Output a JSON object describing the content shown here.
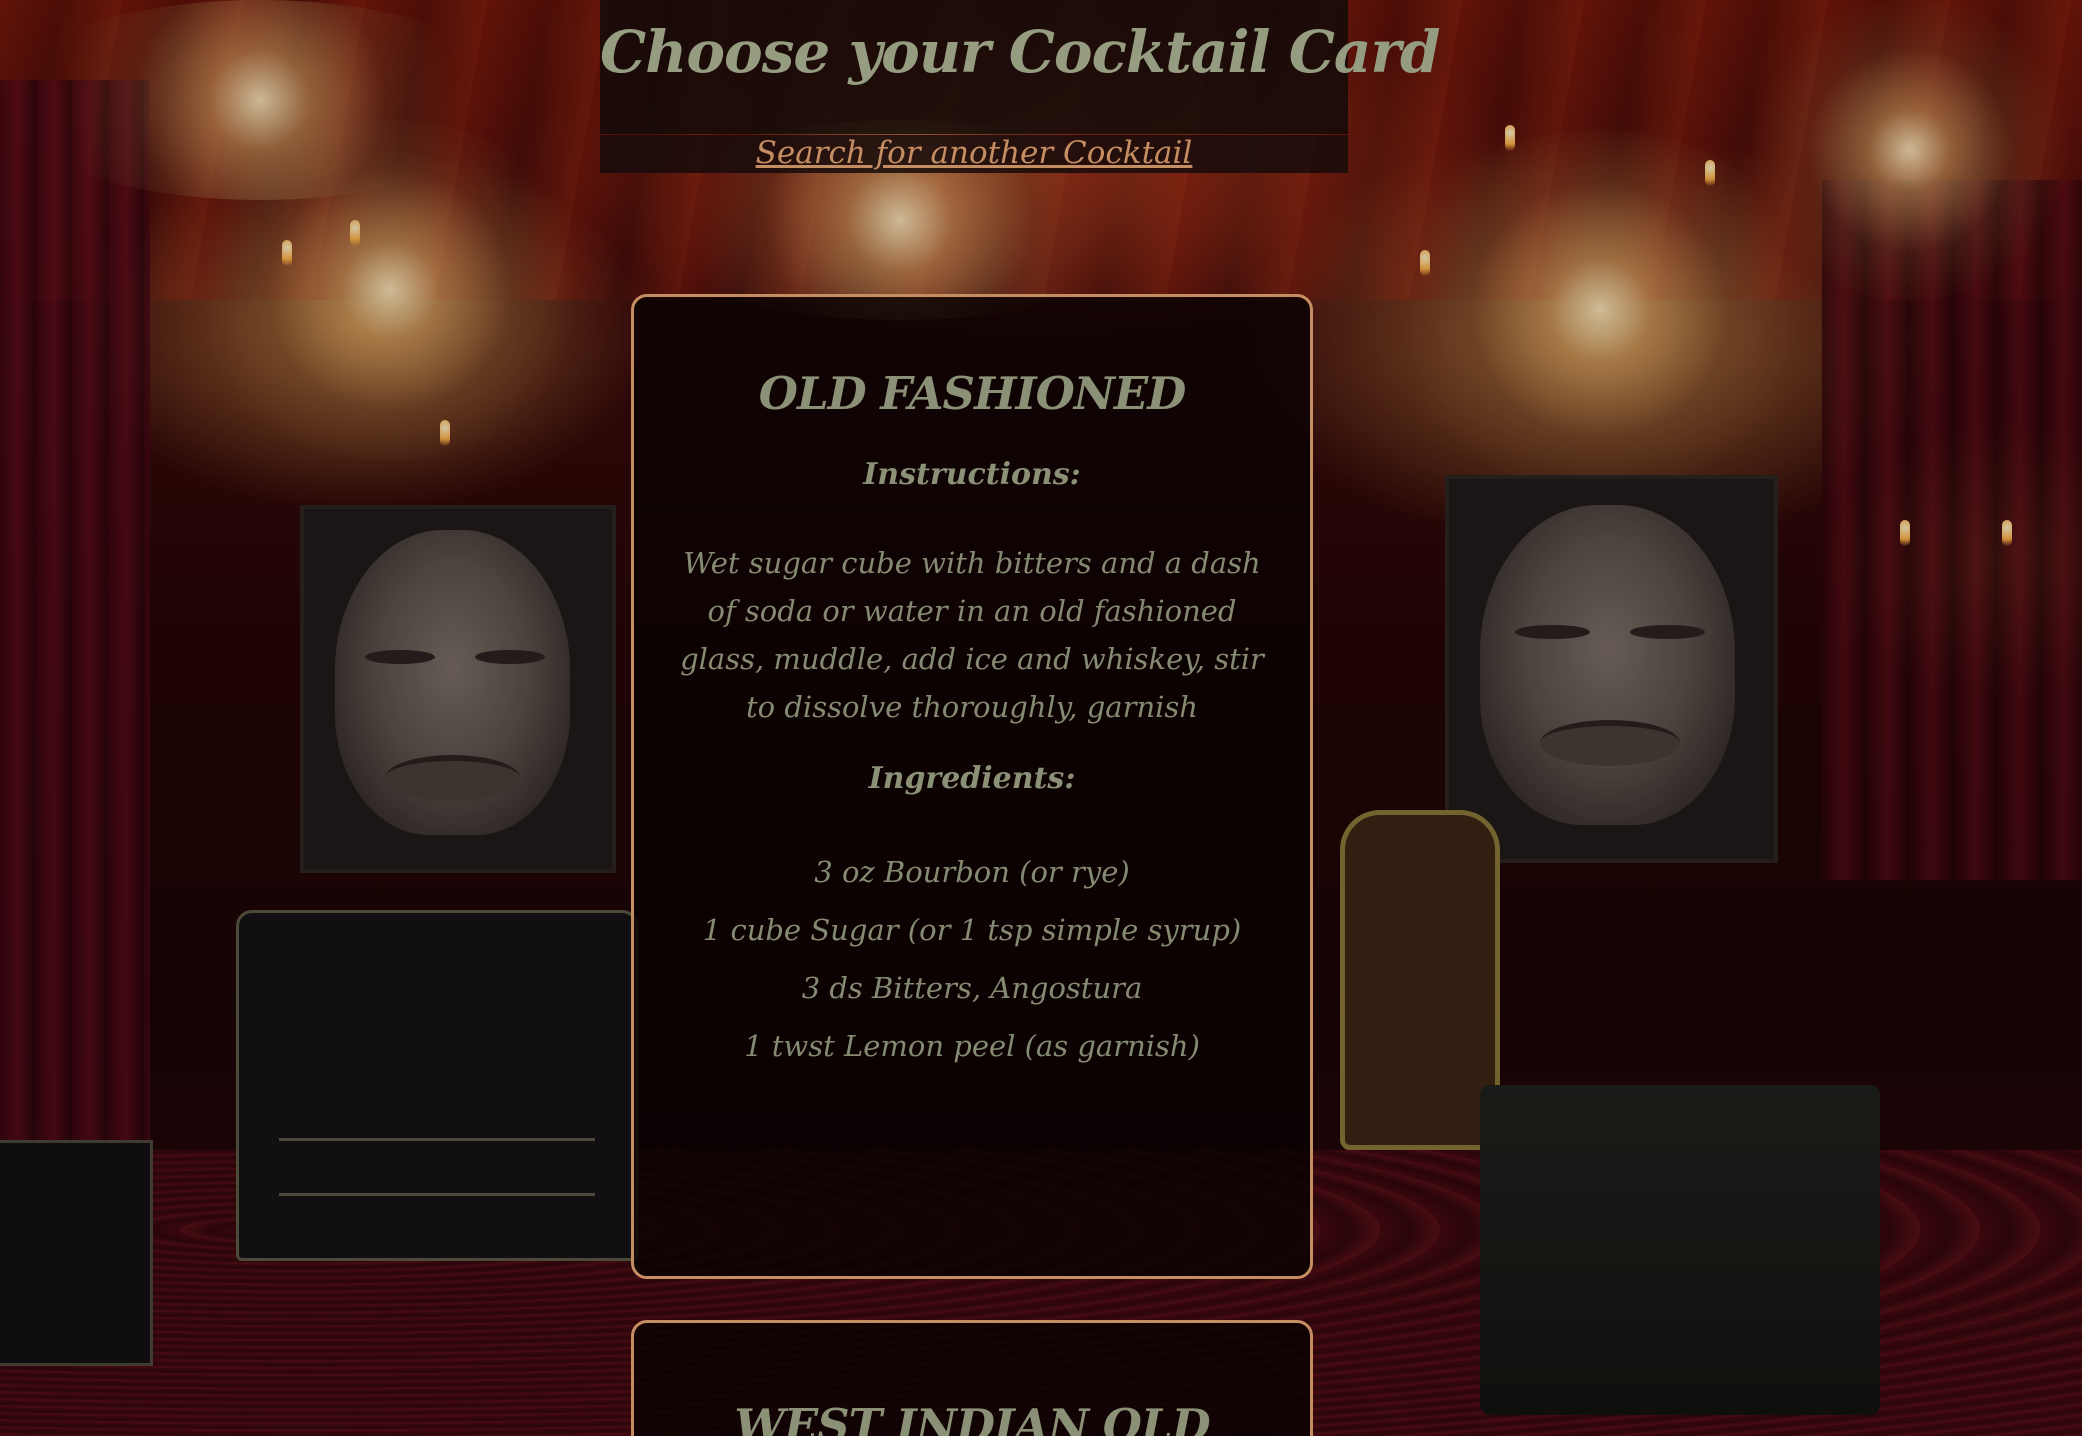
{
  "header": {
    "title": "Choose your Cocktail Card",
    "search_link": "Search for another Cocktail"
  },
  "cards": [
    {
      "name": "OLD FASHIONED",
      "instructions_label": "Instructions:",
      "instructions": "Wet sugar cube with bitters and a dash of soda or water in an old fashioned glass, muddle, add ice and whiskey, stir to dissolve thoroughly, garnish",
      "ingredients_label": "Ingredients:",
      "ingredients": [
        "3 oz Bourbon (or rye)",
        "1 cube Sugar (or 1 tsp simple syrup)",
        "3 ds Bitters, Angostura",
        "1 twst Lemon peel (as garnish)"
      ]
    },
    {
      "name": "WEST INDIAN OLD"
    }
  ],
  "colors": {
    "title_text": "#959c80",
    "card_text": "#858a72",
    "link_and_border": "#c58d62",
    "card_background": "#0a0303"
  }
}
